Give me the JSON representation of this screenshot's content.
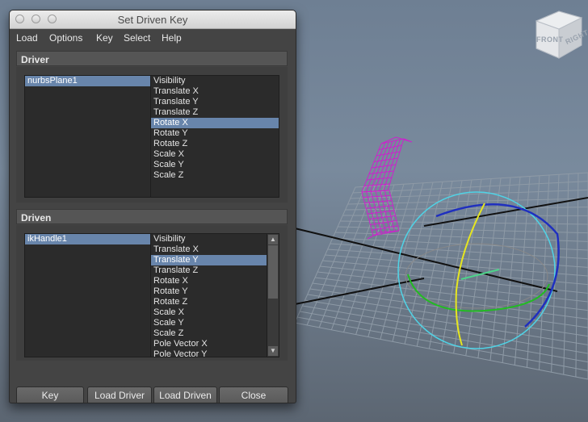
{
  "window": {
    "title": "Set Driven Key"
  },
  "menu": [
    "Load",
    "Options",
    "Key",
    "Select",
    "Help"
  ],
  "driver": {
    "header": "Driver",
    "objects": [
      {
        "label": "nurbsPlane1",
        "selected": true
      }
    ],
    "attributes": [
      {
        "label": "Visibility",
        "selected": false
      },
      {
        "label": "Translate X",
        "selected": false
      },
      {
        "label": "Translate Y",
        "selected": false
      },
      {
        "label": "Translate Z",
        "selected": false
      },
      {
        "label": "Rotate X",
        "selected": true
      },
      {
        "label": "Rotate Y",
        "selected": false
      },
      {
        "label": "Rotate Z",
        "selected": false
      },
      {
        "label": "Scale X",
        "selected": false
      },
      {
        "label": "Scale Y",
        "selected": false
      },
      {
        "label": "Scale Z",
        "selected": false
      }
    ]
  },
  "driven": {
    "header": "Driven",
    "objects": [
      {
        "label": "ikHandle1",
        "selected": true
      }
    ],
    "attributes": [
      {
        "label": "Visibility",
        "selected": false
      },
      {
        "label": "Translate X",
        "selected": false
      },
      {
        "label": "Translate Y",
        "selected": true
      },
      {
        "label": "Translate Z",
        "selected": false
      },
      {
        "label": "Rotate X",
        "selected": false
      },
      {
        "label": "Rotate Y",
        "selected": false
      },
      {
        "label": "Rotate Z",
        "selected": false
      },
      {
        "label": "Scale X",
        "selected": false
      },
      {
        "label": "Scale Y",
        "selected": false
      },
      {
        "label": "Scale Z",
        "selected": false
      },
      {
        "label": "Pole Vector X",
        "selected": false
      },
      {
        "label": "Pole Vector Y",
        "selected": false
      }
    ]
  },
  "buttons": {
    "key": "Key",
    "load_driver": "Load Driver",
    "load_driven": "Load Driven",
    "close": "Close"
  },
  "viewcube": {
    "front": "FRONT",
    "right": "RIGHT"
  },
  "colors": {
    "selection": "#6885ab",
    "nurbs_wire": "#cc22cc",
    "ring_cyan": "#4fd3e6",
    "ring_blue": "#1f2fbf",
    "ring_green": "#22bb22",
    "ring_yellow": "#e6e620"
  }
}
